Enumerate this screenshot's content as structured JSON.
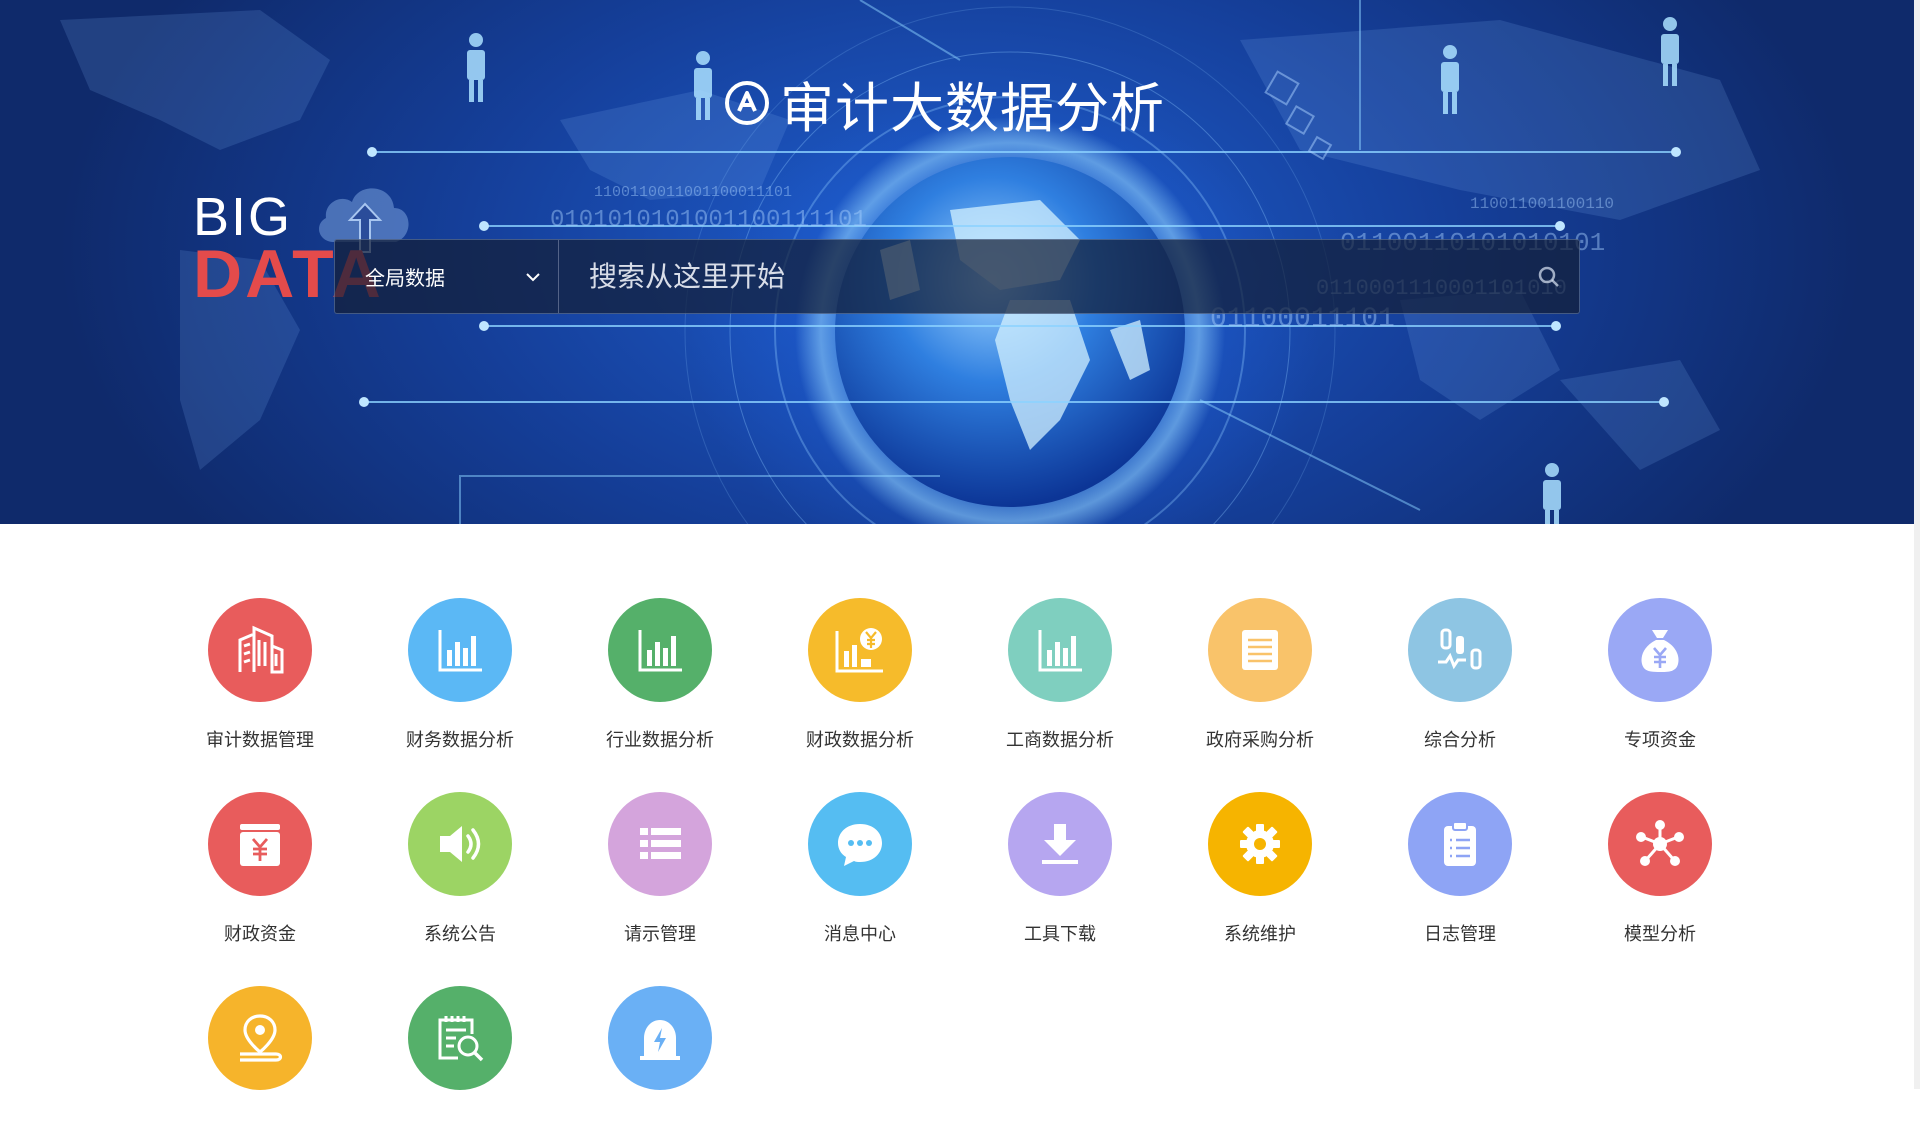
{
  "banner": {
    "title": "审计大数据分析",
    "logo_icon": "audit-logo-icon",
    "big_text": "BIG",
    "data_text": "DATA",
    "binary_lines": [
      "1100110011001100011101",
      "0101010101001100111101",
      "110011001100110",
      "01100110101010101",
      "0110001110001101010",
      "01100011101"
    ],
    "colors": {
      "accent_red": "#e44b4b",
      "banner_dark": "#0f2a6b",
      "banner_mid": "#1f5fd0"
    }
  },
  "search": {
    "scope_label": "全局数据",
    "placeholder": "搜索从这里开始",
    "scope_icon": "chevron-down-icon",
    "button_icon": "search-icon"
  },
  "apps": [
    {
      "label": "审计数据管理",
      "color": "#e85c5c",
      "icon": "building-icon"
    },
    {
      "label": "财务数据分析",
      "color": "#5bb8f5",
      "icon": "bar-chart-icon"
    },
    {
      "label": "行业数据分析",
      "color": "#55b06a",
      "icon": "bar-chart-icon"
    },
    {
      "label": "财政数据分析",
      "color": "#f6bb2b",
      "icon": "finance-chart-icon"
    },
    {
      "label": "工商数据分析",
      "color": "#7fcfbf",
      "icon": "bar-chart-icon"
    },
    {
      "label": "政府采购分析",
      "color": "#f9c36a",
      "icon": "document-icon"
    },
    {
      "label": "综合分析",
      "color": "#8ec5e3",
      "icon": "analysis-icon"
    },
    {
      "label": "专项资金",
      "color": "#9aa8f5",
      "icon": "money-bag-icon"
    },
    {
      "label": "财政资金",
      "color": "#e85c5c",
      "icon": "wallet-yen-icon"
    },
    {
      "label": "系统公告",
      "color": "#9cd464",
      "icon": "speaker-icon"
    },
    {
      "label": "请示管理",
      "color": "#d4a4dc",
      "icon": "list-icon"
    },
    {
      "label": "消息中心",
      "color": "#55bdf2",
      "icon": "chat-icon"
    },
    {
      "label": "工具下载",
      "color": "#b6a6f0",
      "icon": "download-icon"
    },
    {
      "label": "系统维护",
      "color": "#f6b400",
      "icon": "gear-icon"
    },
    {
      "label": "日志管理",
      "color": "#8ea4f5",
      "icon": "clipboard-icon"
    },
    {
      "label": "模型分析",
      "color": "#e85c5c",
      "icon": "network-icon"
    },
    {
      "label": "",
      "color": "#f6b42b",
      "icon": "location-pin-icon"
    },
    {
      "label": "",
      "color": "#55b06a",
      "icon": "document-search-icon"
    },
    {
      "label": "",
      "color": "#6ab0f5",
      "icon": "alarm-icon"
    }
  ]
}
